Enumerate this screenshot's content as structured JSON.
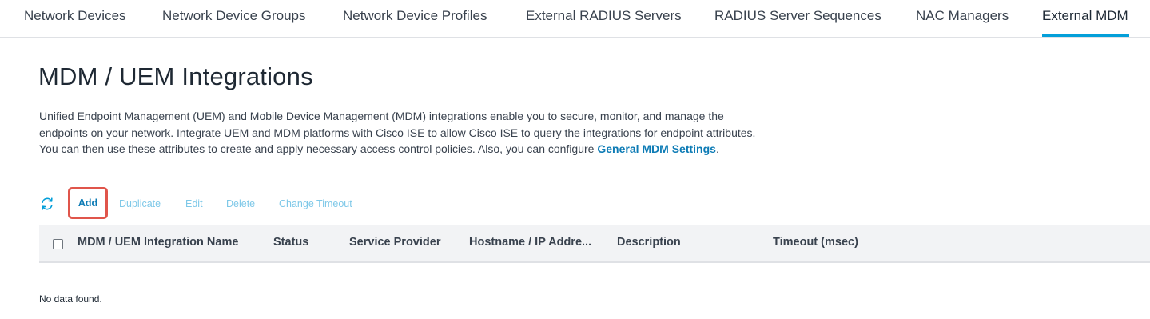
{
  "tabs": [
    {
      "label": "Network Devices",
      "active": false
    },
    {
      "label": "Network Device Groups",
      "active": false
    },
    {
      "label": "Network Device Profiles",
      "active": false
    },
    {
      "label": "External RADIUS Servers",
      "active": false
    },
    {
      "label": "RADIUS Server Sequences",
      "active": false
    },
    {
      "label": "NAC Managers",
      "active": false
    },
    {
      "label": "External MDM",
      "active": true
    }
  ],
  "page": {
    "title": "MDM / UEM Integrations",
    "description": "Unified Endpoint Management (UEM) and Mobile Device Management (MDM) integrations enable you to secure, monitor, and manage the endpoints on your network. Integrate UEM and MDM platforms with Cisco ISE to allow Cisco ISE to query the integrations for endpoint attributes. You can then use these attributes to create and apply necessary access control policies. Also, you can configure",
    "settings_link": "General MDM Settings",
    "description_end": "."
  },
  "toolbar": {
    "refresh_icon": "refresh-icon",
    "add": "Add",
    "duplicate": "Duplicate",
    "edit": "Edit",
    "delete": "Delete",
    "change_timeout": "Change Timeout"
  },
  "table": {
    "columns": [
      "MDM / UEM Integration Name",
      "Status",
      "Service Provider",
      "Hostname / IP Addre...",
      "Description",
      "Timeout (msec)"
    ],
    "empty_message": "No data found."
  },
  "colors": {
    "accent": "#049fd9",
    "link": "#0d7bb5",
    "disabled_action": "#7ec8e8",
    "highlight_border": "#e0554b"
  }
}
